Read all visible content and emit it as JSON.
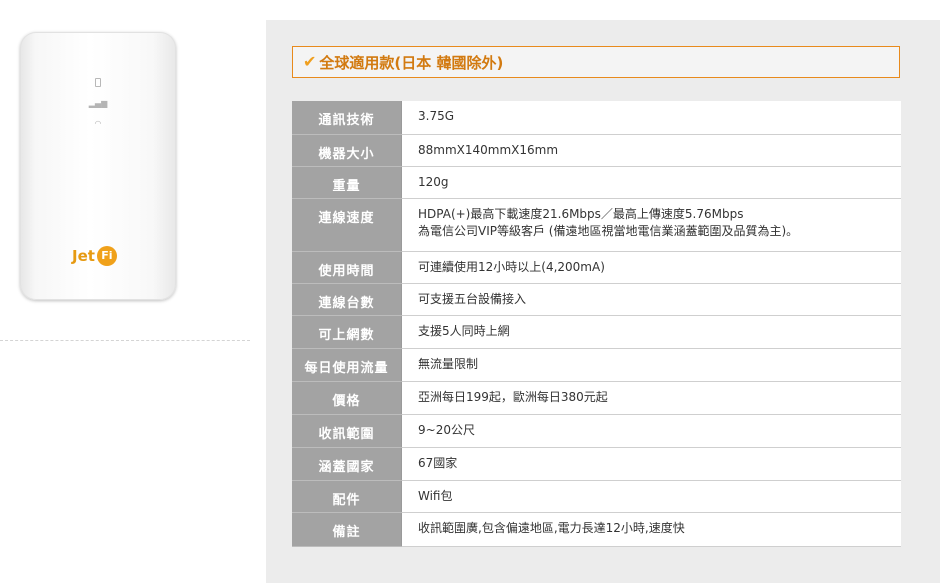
{
  "device": {
    "brand_logo_text": "Jet",
    "brand_logo_badge": "Fi",
    "indicator_icons": [
      "battery-icon",
      "signal-icon",
      "wifi-icon"
    ]
  },
  "panel": {
    "title_icon": "checkmark-icon",
    "title": "全球適用款(日本 韓國除外)",
    "accent_color": "#e88a1c",
    "header_cell_color": "#a3a3a3"
  },
  "specs": [
    {
      "label": "通訊技術",
      "lines": [
        "3.75G"
      ]
    },
    {
      "label": "機器大小",
      "lines": [
        "88mmX140mmX16mm"
      ]
    },
    {
      "label": "重量",
      "lines": [
        "120g"
      ]
    },
    {
      "label": "連線速度",
      "lines": [
        "HDPA(+)最高下載速度21.6Mbps／最高上傳速度5.76Mbps",
        "為電信公司VIP等級客戶 (備遠地區視當地電信業涵蓋範圍及品質為主)。"
      ]
    },
    {
      "label": "使用時間",
      "lines": [
        "可連續使用12小時以上(4,200mA)"
      ]
    },
    {
      "label": "連線台數",
      "lines": [
        "可支援五台設備接入"
      ]
    },
    {
      "label": "可上網數",
      "lines": [
        "支援5人同時上網"
      ]
    },
    {
      "label": "每日使用流量",
      "lines": [
        "無流量限制"
      ]
    },
    {
      "label": "價格",
      "lines": [
        "亞洲每日199起，歐洲每日380元起"
      ]
    },
    {
      "label": "收訊範圍",
      "lines": [
        "9~20公尺"
      ]
    },
    {
      "label": "涵蓋國家",
      "lines": [
        "67國家"
      ]
    },
    {
      "label": "配件",
      "lines": [
        "Wifi包"
      ]
    },
    {
      "label": "備註",
      "lines": [
        "收訊範圍廣,包含偏遠地區,電力長達12小時,速度快"
      ]
    }
  ]
}
